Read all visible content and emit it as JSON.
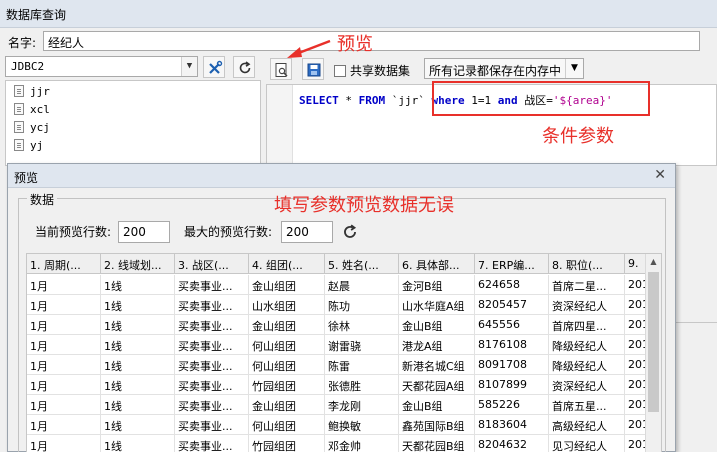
{
  "window": {
    "title": "数据库查询"
  },
  "name_field": {
    "label": "名字:",
    "value": "经纪人"
  },
  "connection": {
    "selected": "JDBC2"
  },
  "tables": [
    "jjr",
    "xcl",
    "ycj",
    "yj"
  ],
  "toolbar": {
    "share_label": "共享数据集",
    "cache_mode": "所有记录都保存在内存中"
  },
  "sql": {
    "select": "SELECT",
    "star": " * ",
    "from": "FROM",
    "table": " `jjr` ",
    "where": "where",
    "cond1": " 1=1 ",
    "and": "and",
    "cond2": " 战区=",
    "param": "'${area}'"
  },
  "annotations": {
    "preview": "预览",
    "condition": "条件参数",
    "fill": "填写参数预览数据无误"
  },
  "colors": {
    "annotation": "#e8302a",
    "keyword": "#0000c8",
    "string": "#b0008f"
  },
  "dialog": {
    "title": "预览",
    "group_label": "数据",
    "current_rows_label": "当前预览行数:",
    "current_rows_value": "200",
    "max_rows_label": "最大的预览行数:",
    "max_rows_value": "200"
  },
  "grid": {
    "headers": [
      "1. 周期(...",
      "2. 线域划...",
      "3. 战区(...",
      "4. 组团(...",
      "5. 姓名(...",
      "6. 具体部...",
      "7. ERP编...",
      "8. 职位(...",
      "9."
    ],
    "rows": [
      [
        "1月",
        "1线",
        "买卖事业...",
        "金山组团",
        "赵晨",
        "金河B组",
        "624658",
        "首席二星...",
        "201"
      ],
      [
        "1月",
        "1线",
        "买卖事业...",
        "山水组团",
        "陈功",
        "山水华庭A组",
        "8205457",
        "资深经纪人",
        "201"
      ],
      [
        "1月",
        "1线",
        "买卖事业...",
        "金山组团",
        "徐林",
        "金山B组",
        "645556",
        "首席四星...",
        "201"
      ],
      [
        "1月",
        "1线",
        "买卖事业...",
        "何山组团",
        "谢雷骁",
        "港龙A组",
        "8176108",
        "降级经纪人",
        "201"
      ],
      [
        "1月",
        "1线",
        "买卖事业...",
        "何山组团",
        "陈雷",
        "新港名城C组",
        "8091708",
        "降级经纪人",
        "201"
      ],
      [
        "1月",
        "1线",
        "买卖事业...",
        "竹园组团",
        "张德胜",
        "天都花园A组",
        "8107899",
        "资深经纪人",
        "201"
      ],
      [
        "1月",
        "1线",
        "买卖事业...",
        "金山组团",
        "李龙刚",
        "金山B组",
        "585226",
        "首席五星...",
        "201"
      ],
      [
        "1月",
        "1线",
        "买卖事业...",
        "何山组团",
        "鲍换敏",
        "鑫苑国际B组",
        "8183604",
        "高级经纪人",
        "201"
      ],
      [
        "1月",
        "1线",
        "买卖事业...",
        "竹园组团",
        "邓金帅",
        "天都花园B组",
        "8204632",
        "见习经纪人",
        "201"
      ]
    ]
  }
}
